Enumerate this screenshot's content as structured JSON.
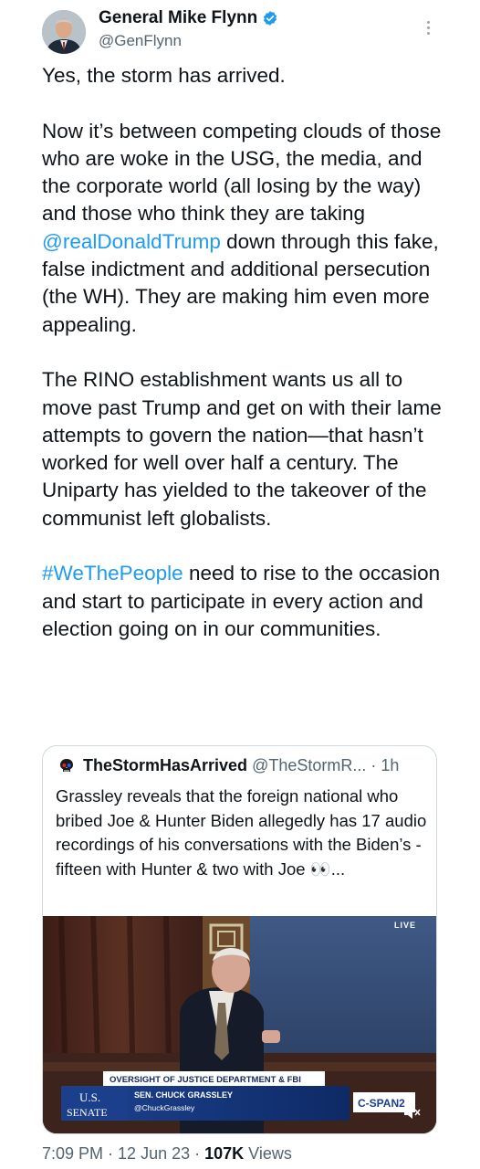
{
  "author": {
    "name": "General Mike Flynn",
    "handle": "@GenFlynn"
  },
  "tweet": {
    "p1": "Yes, the storm has arrived.",
    "p2_before": "Now it’s between competing clouds of those who are woke in the USG, the media, and the corporate world (all losing by the way) and those who think they are taking ",
    "p2_mention": "@realDonaldTrump",
    "p2_after": " down through this fake, false indictment and additional persecution (the WH). They are making him even more appealing.",
    "p3": "The RINO establishment wants us all to move past Trump and get on with their lame attempts to govern the nation—that hasn’t worked for well over half a century. The Uniparty has yielded to the takeover of the communist left globalists.",
    "p4_hashtag": "#WeThePeople",
    "p4_after": " need to rise to the occasion and start to participate in every action and election going on in our communities."
  },
  "quote": {
    "name": "TheStormHasArrived",
    "handle": "@TheStormR...",
    "time": "· 1h",
    "text": "Grassley reveals that the foreign national who bribed Joe & Hunter Biden allegedly has 17 audio recordings of his conversations with the Biden’s - fifteen with Hunter & two with Joe 👀...",
    "video": {
      "live": "LIVE",
      "chyron_top": "OVERSIGHT OF JUSTICE DEPARTMENT & FBI",
      "speaker": "SEN. CHUCK GRASSLEY",
      "speaker_handle": "@ChuckGrassley",
      "senate_us": "U.S.",
      "senate_word": "SENATE",
      "network": "C-SPAN2"
    }
  },
  "meta": {
    "time": "7:09 PM",
    "date": "12 Jun 23",
    "views_count": "107K",
    "views_label": "Views"
  },
  "icons": [
    "verified-badge-icon",
    "more-options-icon",
    "skull-avatar-icon",
    "mute-icon"
  ],
  "colors": {
    "link": "#1d9bf0",
    "secondary": "#536471",
    "verified": "#1d9bf0"
  }
}
